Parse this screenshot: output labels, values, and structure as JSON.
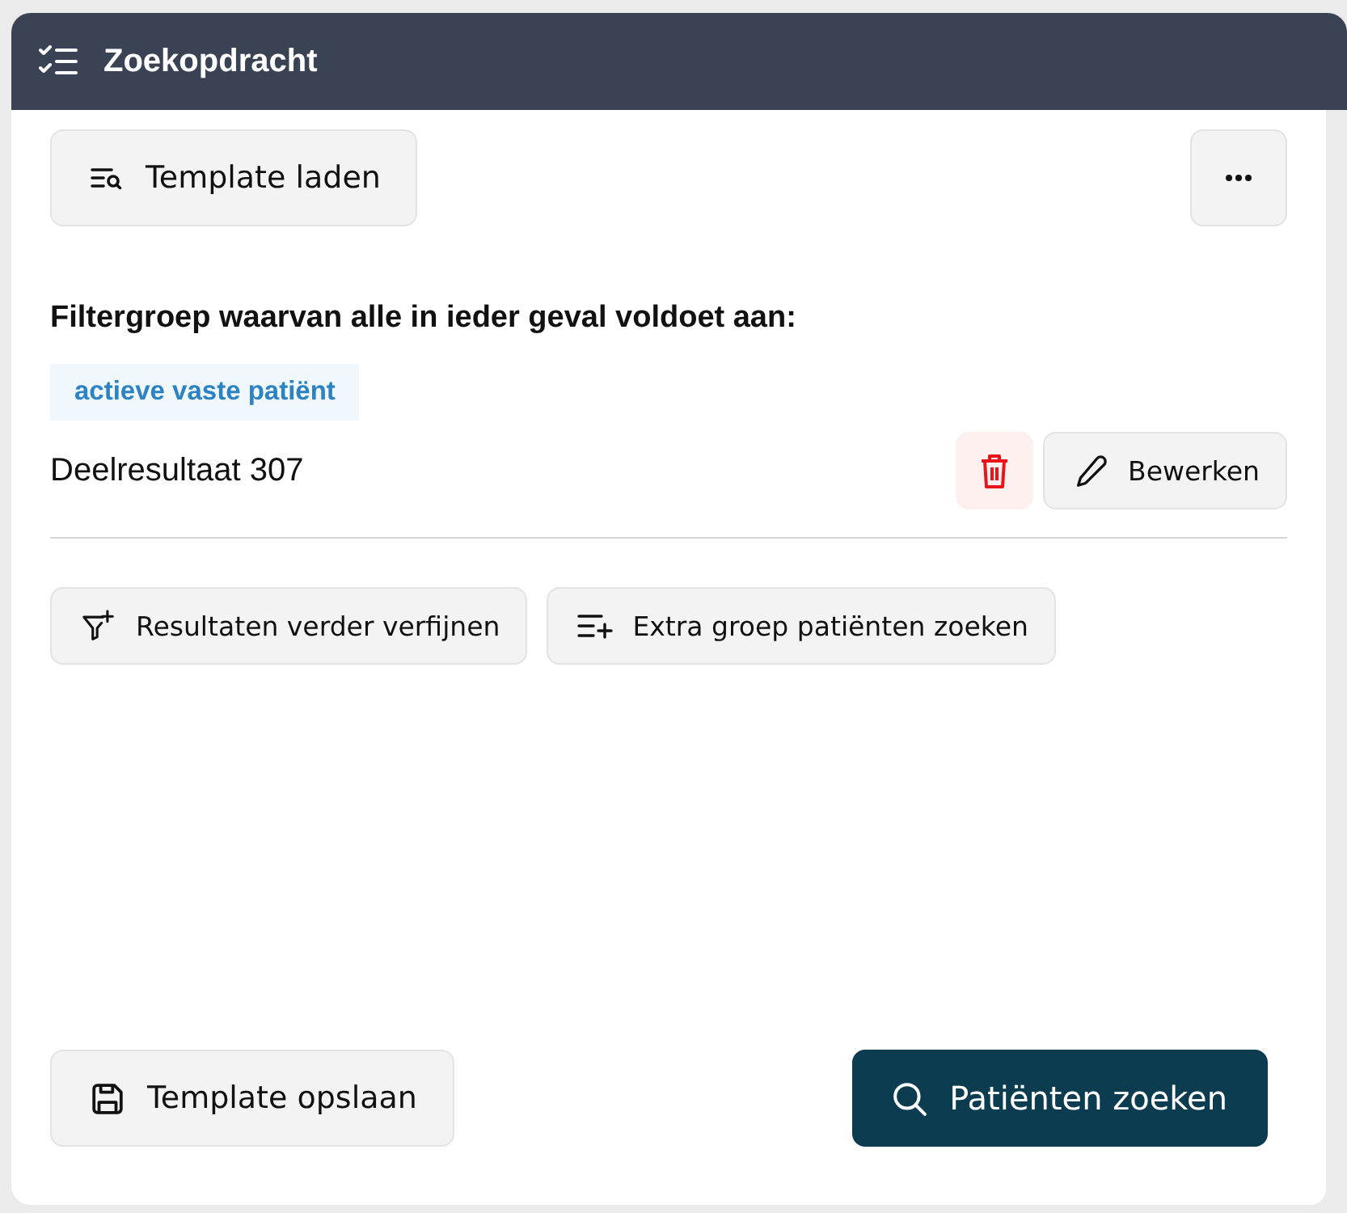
{
  "window": {
    "title": "Zoekopdracht"
  },
  "toolbar": {
    "load_button": "Template laden"
  },
  "filter_group": {
    "heading": "Filtergroep waarvan alle in ieder geval voldoet aan:",
    "tags": [
      "actieve vaste patiënt"
    ],
    "result": "Deelresultaat 307",
    "edit_button": "Bewerken"
  },
  "actions": [
    {
      "label": "Resultaten verder verfijnen",
      "kind": "refine"
    },
    {
      "label": "Extra groep patiënten zoeken",
      "kind": "add_group"
    }
  ],
  "footer": {
    "save_button": "Template opslaan",
    "search_button": "Patiënten zoeken"
  }
}
